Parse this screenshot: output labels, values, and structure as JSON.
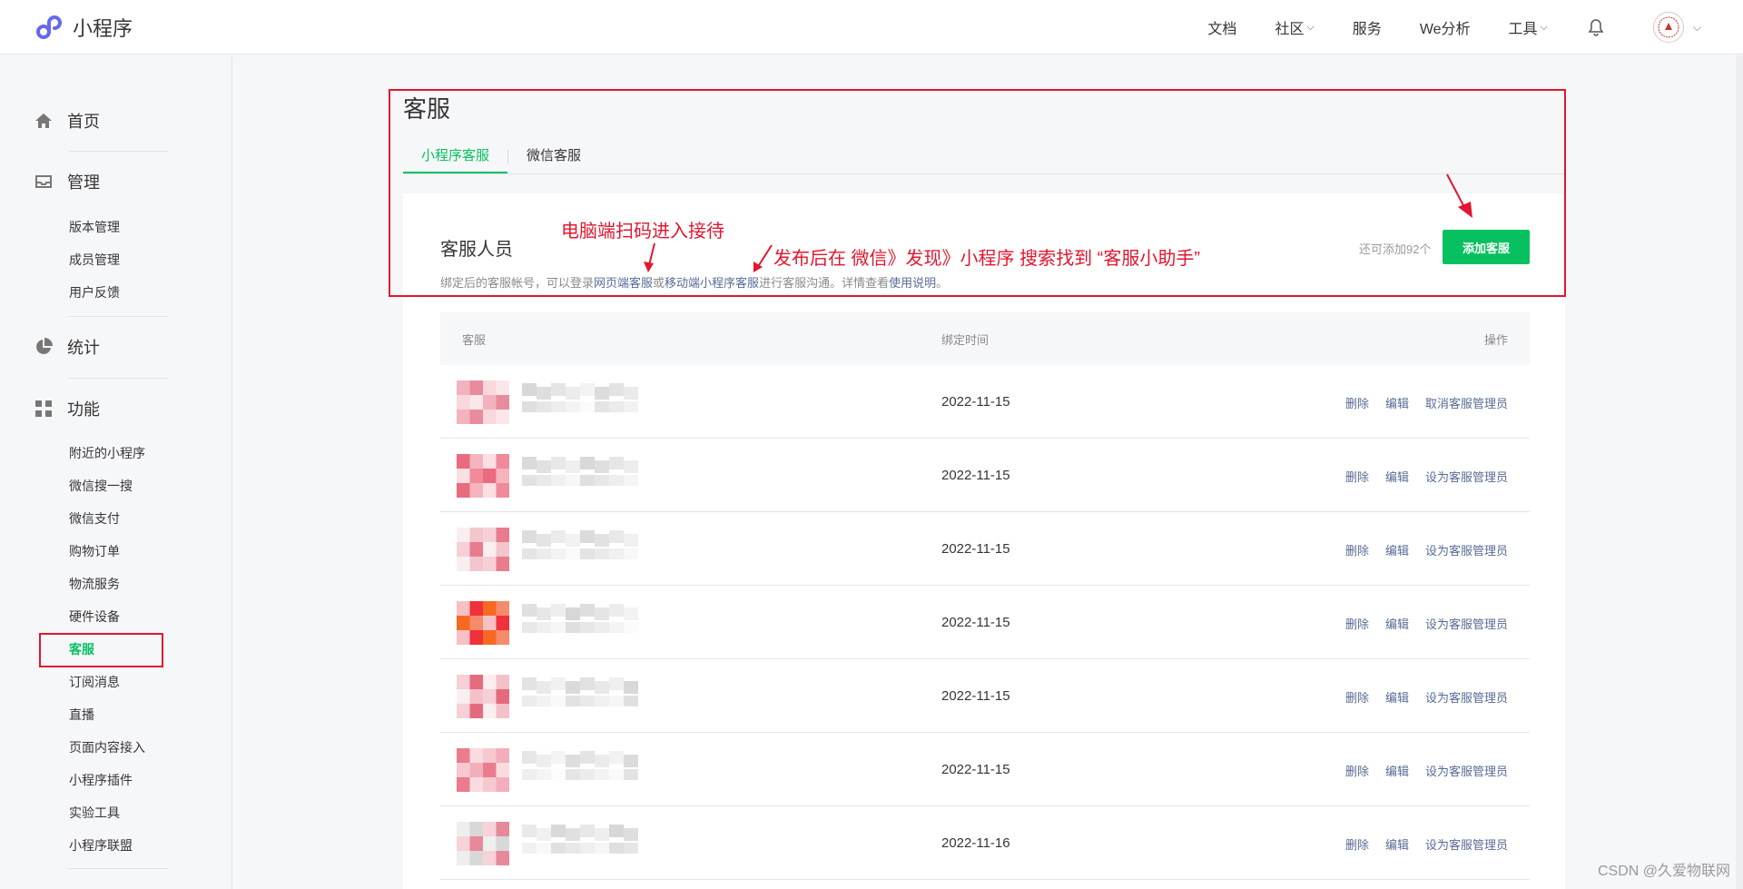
{
  "brand": {
    "name": "小程序"
  },
  "topnav": {
    "docs": "文档",
    "community": "社区",
    "service": "服务",
    "analysis": "We分析",
    "tools": "工具"
  },
  "sidebar": {
    "home": "首页",
    "manage": "管理",
    "manage_items": [
      "版本管理",
      "成员管理",
      "用户反馈"
    ],
    "stats": "统计",
    "features": "功能",
    "feature_items": [
      "附近的小程序",
      "微信搜一搜",
      "微信支付",
      "购物订单",
      "物流服务",
      "硬件设备",
      "客服",
      "订阅消息",
      "直播",
      "页面内容接入",
      "小程序插件",
      "实验工具",
      "小程序联盟"
    ]
  },
  "page": {
    "title": "客服",
    "tabs": [
      "小程序客服",
      "微信客服"
    ]
  },
  "section": {
    "title": "客服人员",
    "desc_1": "绑定后的客服帐号，可以登录",
    "desc_link_1": "网页端客服",
    "desc_2": "或",
    "desc_link_2": "移动端小程序客服",
    "desc_3": "进行客服沟通。详情查看",
    "desc_link_3": "使用说明",
    "desc_4": "。",
    "quota": "还可添加92个",
    "add_button": "添加客服"
  },
  "annotations": {
    "a1": "电脑端扫码进入接待",
    "a2": "发布后在 微信》发现》小程序 搜索找到 “客服小助手”"
  },
  "table": {
    "columns": [
      "客服",
      "绑定时间",
      "操作"
    ],
    "rows": [
      {
        "date": "2022-11-15",
        "ops": [
          "删除",
          "编辑",
          "取消客服管理员"
        ]
      },
      {
        "date": "2022-11-15",
        "ops": [
          "删除",
          "编辑",
          "设为客服管理员"
        ]
      },
      {
        "date": "2022-11-15",
        "ops": [
          "删除",
          "编辑",
          "设为客服管理员"
        ]
      },
      {
        "date": "2022-11-15",
        "ops": [
          "删除",
          "编辑",
          "设为客服管理员"
        ]
      },
      {
        "date": "2022-11-15",
        "ops": [
          "删除",
          "编辑",
          "设为客服管理员"
        ]
      },
      {
        "date": "2022-11-15",
        "ops": [
          "删除",
          "编辑",
          "设为客服管理员"
        ]
      },
      {
        "date": "2022-11-16",
        "ops": [
          "删除",
          "编辑",
          "设为客服管理员"
        ]
      }
    ]
  },
  "watermark": "CSDN @久爱物联网",
  "colors": {
    "accent": "#07c160",
    "link": "#576b95",
    "annotation": "#e2162e"
  }
}
